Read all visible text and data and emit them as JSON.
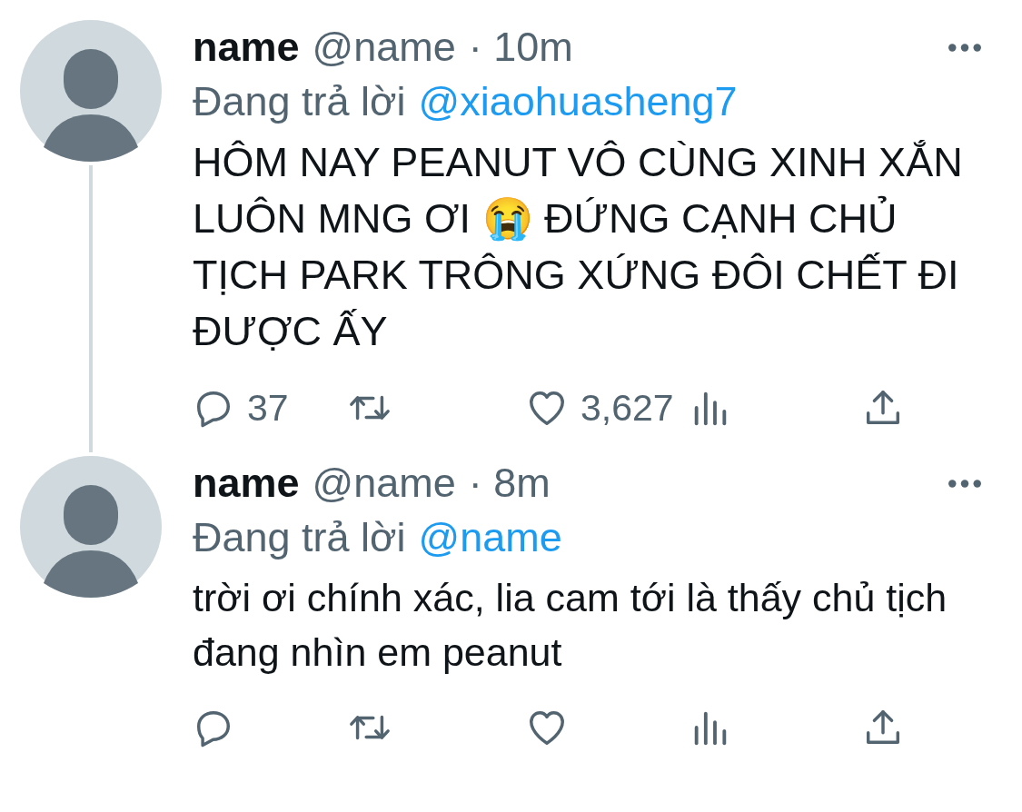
{
  "tweets": [
    {
      "name": "name",
      "handle": "@name",
      "time": "· 10m",
      "reply_prefix": "Đang trả lời",
      "reply_to": "@xiaohuasheng7",
      "text": "HÔM NAY PEANUT VÔ CÙNG XINH XẮN LUÔN MNG ƠI 😭  ĐỨNG CẠNH CHỦ TỊCH PARK TRÔNG XỨNG ĐÔI CHẾT ĐI ĐƯỢC ẤY",
      "thread_line": true,
      "actions": [
        {
          "kind": "reply",
          "count": "37"
        },
        {
          "kind": "retweet"
        },
        {
          "kind": "like",
          "count": "3,627"
        },
        {
          "kind": "views"
        },
        {
          "kind": "share"
        }
      ]
    },
    {
      "name": "name",
      "handle": "@name",
      "time": "· 8m",
      "reply_prefix": "Đang trả lời",
      "reply_to": "@name",
      "text": "trời ơi chính xác, lia cam tới là thấy chủ tịch đang nhìn em peanut",
      "thread_line": false,
      "actions": [
        {
          "kind": "reply"
        },
        {
          "kind": "retweet"
        },
        {
          "kind": "like"
        },
        {
          "kind": "views"
        },
        {
          "kind": "share"
        }
      ]
    }
  ]
}
